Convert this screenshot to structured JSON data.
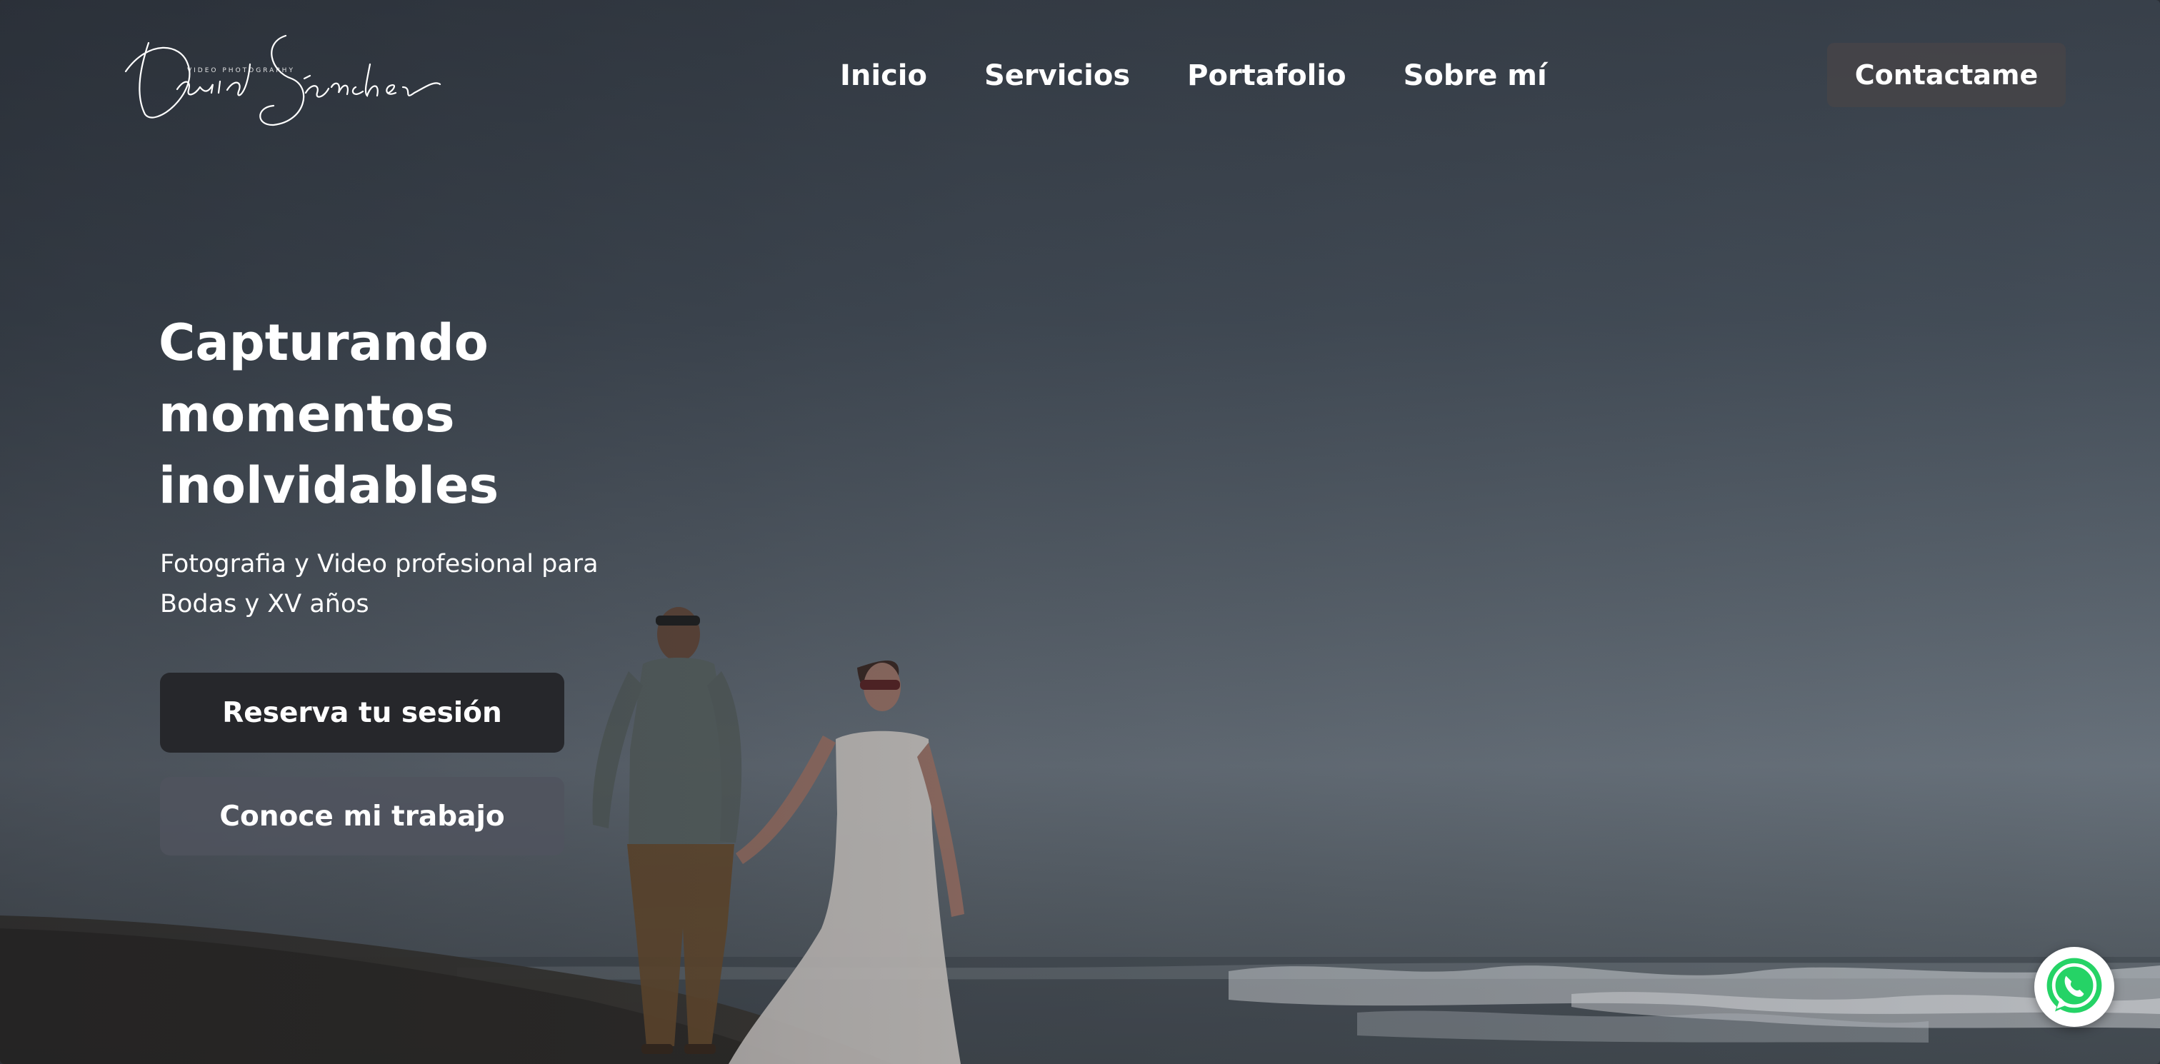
{
  "brand": {
    "logo_text": "David Sánchez",
    "logo_subtitle": "VIDEO PHOTOGRAPHY"
  },
  "nav": {
    "items": [
      {
        "label": "Inicio"
      },
      {
        "label": "Servicios"
      },
      {
        "label": "Portafolio"
      },
      {
        "label": "Sobre mí"
      }
    ],
    "contact_label": "Contactame"
  },
  "hero": {
    "title_lines": [
      "Capturando",
      "momentos",
      "inolvidables"
    ],
    "subtitle_lines": [
      "Fotografia y Video profesional para",
      "Bodas y XV años"
    ],
    "primary_cta": "Reserva tu sesión",
    "secondary_cta": "Conoce mi trabajo"
  },
  "floating": {
    "icon": "whatsapp-icon"
  },
  "colors": {
    "primary_button_bg": "#26272b",
    "secondary_button_bg": "#50545e",
    "contact_button_bg": "#464448",
    "whatsapp_green": "#25d366",
    "text": "#ffffff"
  }
}
